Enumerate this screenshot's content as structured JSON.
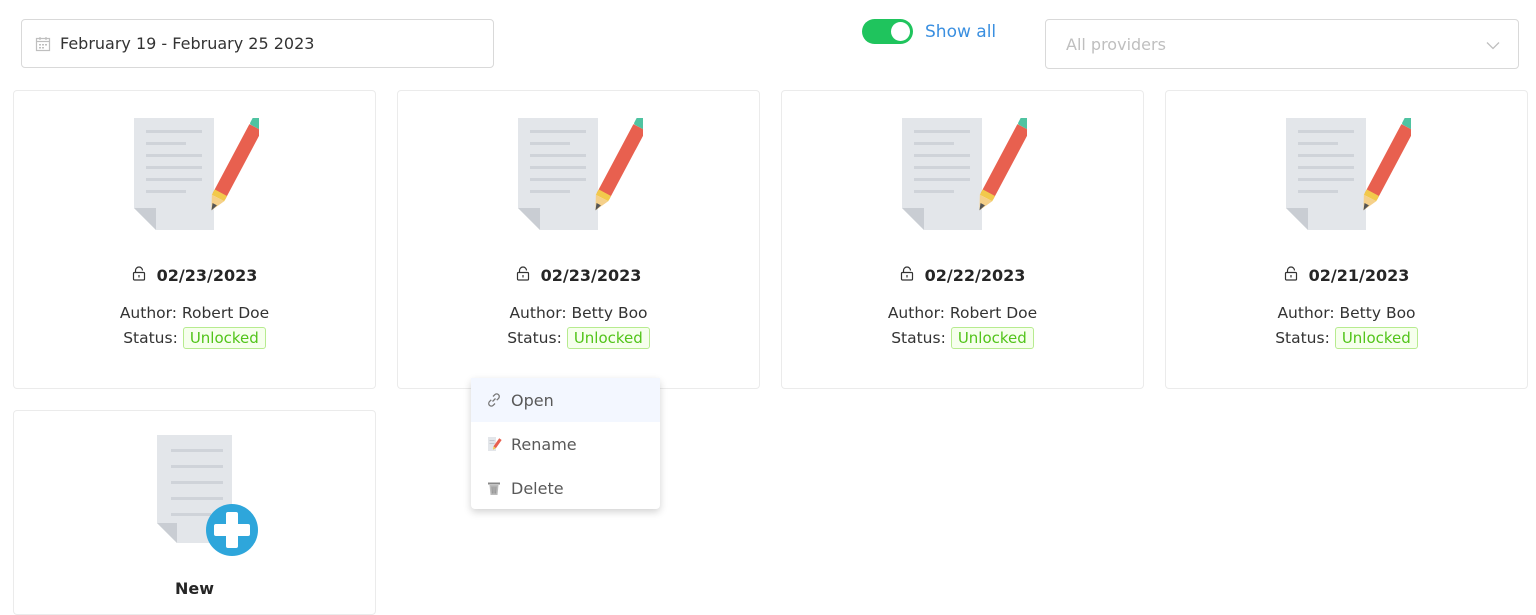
{
  "filters": {
    "date_range": "February 19 - February 25 2023",
    "show_all_label": "Show all",
    "show_all_on": true,
    "provider_placeholder": "All providers"
  },
  "labels": {
    "author_prefix": "Author: ",
    "status_prefix": "Status:"
  },
  "cards": [
    {
      "date": "02/23/2023",
      "author": "Robert Doe",
      "status": "Unlocked"
    },
    {
      "date": "02/23/2023",
      "author": "Betty Boo",
      "status": "Unlocked"
    },
    {
      "date": "02/22/2023",
      "author": "Robert Doe",
      "status": "Unlocked"
    },
    {
      "date": "02/21/2023",
      "author": "Betty Boo",
      "status": "Unlocked"
    }
  ],
  "new_card": {
    "label": "New"
  },
  "context_menu": {
    "items": [
      {
        "label": "Open",
        "icon": "link-icon"
      },
      {
        "label": "Rename",
        "icon": "rename-icon"
      },
      {
        "label": "Delete",
        "icon": "trash-icon"
      }
    ]
  },
  "colors": {
    "toggle_on": "#1fc45d",
    "link": "#3a8fe0",
    "status_green": "#52c41a",
    "pencil_red": "#e8604f",
    "pencil_tip": "#4fc3a1",
    "plus_blue": "#2ea6db"
  }
}
